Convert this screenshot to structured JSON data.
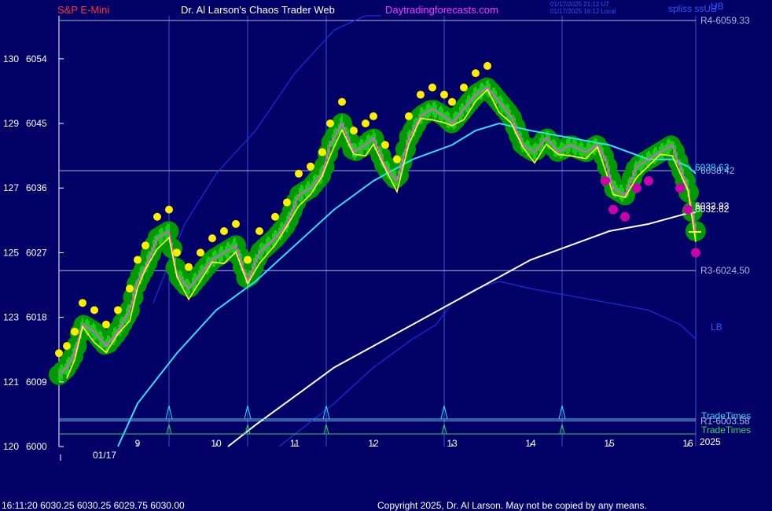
{
  "header": {
    "left_title": "S&P E-Mini",
    "center_title": "Dr. Al Larson's Chaos Trader Web",
    "site": "Daytradingforecasts.com",
    "timestamp_utc": "01/17/2025 21:12 UT",
    "timestamp_local": "01/17/2025 16:12 Local",
    "sub_tag": "spliss ssUB"
  },
  "footer": {
    "quote": "16:11:20  6030.25 6030.25 6029.75 6030.00",
    "copyright": "Copyright 2025, Dr. Al Larson. May not be copied by any means."
  },
  "colors": {
    "background": "#000066",
    "price": "#33ff33",
    "cloud": "#009900",
    "yellow_dots": "#ffee00",
    "magenta_dots": "#cc00aa",
    "avg_fast": "#ffff33",
    "avg_mid": "#ff44ff",
    "avg_cyan": "#33ddff",
    "avg_white": "#ffffff",
    "band": "#1a2fdd",
    "grid": "#3a55cc",
    "level_lines": "#aab8e0",
    "timing": "#33ddff",
    "timing2": "#33cc55"
  },
  "chart_data": {
    "type": "line",
    "title": "S&P E-Mini",
    "xlabel": "",
    "ylabel": "",
    "xlim": [
      8.0,
      16.0
    ],
    "ylim": [
      6000,
      6060
    ],
    "date_label": "01/17",
    "year_label": "2025",
    "x_ticks": [
      9,
      10,
      11,
      12,
      13,
      14,
      15,
      16
    ],
    "y_ticks": [
      {
        "value": 6000,
        "left": "120"
      },
      {
        "value": 6009,
        "left": "121"
      },
      {
        "value": 6018,
        "left": "123"
      },
      {
        "value": 6027,
        "left": "125"
      },
      {
        "value": 6036,
        "left": "127"
      },
      {
        "value": 6045,
        "left": "129"
      },
      {
        "value": 6054,
        "left": "130"
      }
    ],
    "levels": [
      {
        "name": "R4-6059.33",
        "value": 6059.33
      },
      {
        "name": "6038.42",
        "value": 6038.42
      },
      {
        "name": "R3-6024.50",
        "value": 6024.5
      },
      {
        "name": "R1-6003.58",
        "value": 6003.58
      }
    ],
    "right_labels": {
      "cyan_value": "6038.63",
      "value_a": "6032.93",
      "value_b": "6032.62",
      "ub": "UB",
      "lb": "LB",
      "timetimes": "TradeTimes",
      "tradetimes": "TradeTimes"
    },
    "vertical_markers": [
      9.4,
      10.4,
      11.4,
      12.9,
      14.4
    ],
    "price": {
      "x": [
        8.0,
        8.1,
        8.2,
        8.3,
        8.45,
        8.6,
        8.75,
        8.9,
        9.0,
        9.1,
        9.25,
        9.4,
        9.5,
        9.65,
        9.8,
        9.95,
        10.1,
        10.25,
        10.4,
        10.55,
        10.75,
        10.9,
        11.05,
        11.2,
        11.35,
        11.45,
        11.6,
        11.75,
        11.9,
        12.0,
        12.15,
        12.3,
        12.45,
        12.6,
        12.75,
        12.9,
        13.0,
        13.15,
        13.3,
        13.45,
        13.6,
        13.75,
        13.9,
        14.05,
        14.2,
        14.35,
        14.5,
        14.7,
        14.85,
        14.95,
        15.05,
        15.2,
        15.35,
        15.5,
        15.65,
        15.8,
        15.9,
        16.0,
        16.1
      ],
      "y": [
        6010,
        6011,
        6013,
        6017,
        6016,
        6014,
        6016,
        6019,
        6023,
        6025,
        6029,
        6030,
        6024,
        6022,
        6024,
        6026,
        6027,
        6028,
        6023,
        6027,
        6029,
        6031,
        6035,
        6036,
        6038,
        6042,
        6045,
        6041,
        6042,
        6043,
        6039,
        6037,
        6043,
        6046,
        6047,
        6046,
        6045,
        6047,
        6049,
        6050,
        6048,
        6046,
        6042,
        6041,
        6043,
        6041,
        6042,
        6041,
        6042,
        6040,
        6036,
        6035,
        6039,
        6040,
        6041,
        6042,
        6039,
        6036,
        6030
      ]
    },
    "series": [
      {
        "name": "",
        "color_key": "avg_cyan",
        "x": [
          8.75,
          9.0,
          9.5,
          10.0,
          10.5,
          11.0,
          11.5,
          12.0,
          12.5,
          13.0,
          13.3,
          13.6,
          14.0,
          14.5,
          15.0,
          15.5,
          15.8,
          16.0,
          16.1
        ],
        "y": [
          6000,
          6006,
          6013,
          6019,
          6023,
          6028,
          6033,
          6037,
          6040,
          6042,
          6044,
          6045,
          6044,
          6043,
          6042,
          6040,
          6040,
          6039,
          6038
        ]
      },
      {
        "name": "",
        "color_key": "avg_white",
        "x": [
          10.15,
          10.5,
          11.0,
          11.5,
          12.0,
          12.5,
          13.0,
          13.5,
          14.0,
          14.5,
          15.0,
          15.5,
          16.0,
          16.1
        ],
        "y": [
          6000,
          6003,
          6007,
          6011,
          6014,
          6017,
          6020,
          6023,
          6026,
          6028,
          6030,
          6031,
          6032.5,
          6032.6
        ]
      },
      {
        "name": "",
        "color_key": "band",
        "x": [
          10.8,
          11.5,
          12.0,
          12.5,
          12.8,
          13.0,
          13.3,
          13.6,
          14.0,
          14.5,
          15.0,
          15.5,
          15.9,
          16.1
        ],
        "y": [
          6000,
          6006,
          6011,
          6015,
          6017,
          6020,
          6022,
          6023,
          6022,
          6021,
          6020,
          6019,
          6017,
          6015
        ]
      },
      {
        "name": "",
        "color_key": "band",
        "x": [
          9.2,
          9.6,
          10.0,
          10.5,
          11.0,
          11.5,
          11.9,
          12.1
        ],
        "y": [
          6020,
          6031,
          6038,
          6044,
          6052,
          6058,
          6060,
          6060
        ]
      }
    ]
  }
}
